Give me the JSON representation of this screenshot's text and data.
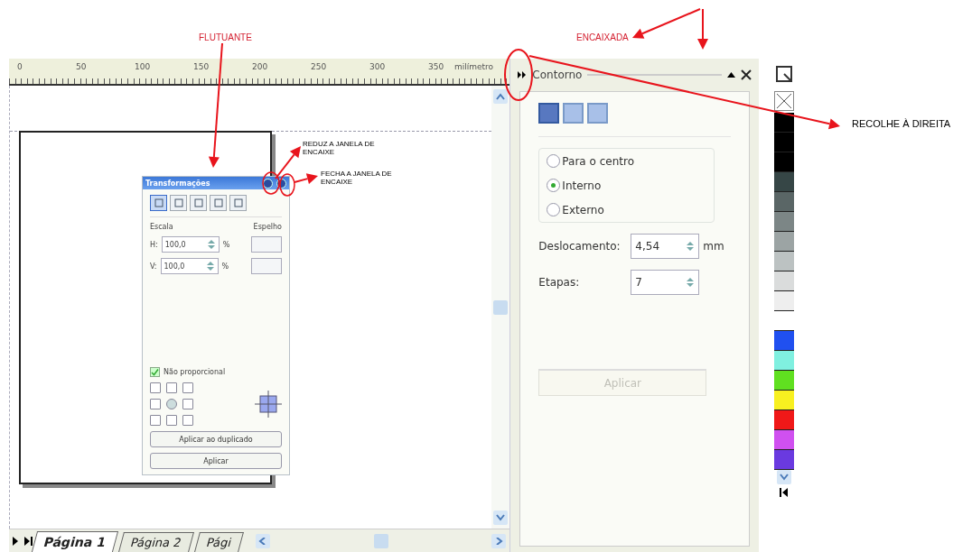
{
  "annotations": {
    "floating": "FLUTUANTE",
    "docked": "ENCAIXADA",
    "collapse_right": "RECOLHE À DIREITA",
    "shrink_docker": "REDUZ A JANELA DE ENCAIXE",
    "close_docker": "FECHA A JANELA DE ENCAIXE"
  },
  "ruler": {
    "ticks": [
      "0",
      "50",
      "100",
      "150",
      "200",
      "250",
      "300",
      "350"
    ],
    "unit": "milímetro"
  },
  "floating_docker": {
    "title": "Transformações",
    "tool_tabs": [
      {
        "selected": true
      },
      {
        "selected": false
      },
      {
        "selected": false
      },
      {
        "selected": false
      },
      {
        "selected": false
      }
    ],
    "scale_label": "Escala",
    "mirror_label": "Espelho",
    "fields": [
      {
        "label": "H:",
        "value": "100,0",
        "unit": "%"
      },
      {
        "label": "V:",
        "value": "100,0",
        "unit": "%"
      }
    ],
    "proportional": {
      "label": "Não proporcional",
      "checked": true
    },
    "anchor_points": [
      {
        "selected": false
      },
      {
        "selected": false
      },
      {
        "selected": false
      },
      {
        "selected": false
      },
      {
        "selected": true
      },
      {
        "selected": false
      },
      {
        "selected": false
      },
      {
        "selected": false
      },
      {
        "selected": false
      }
    ],
    "buttons": [
      "Aplicar ao duplicado",
      "Aplicar"
    ]
  },
  "docker": {
    "title": "Contorno",
    "modes": [
      {
        "selected": true
      },
      {
        "selected": false
      },
      {
        "selected": false
      }
    ],
    "directions": [
      {
        "label": "Para o centro",
        "selected": false
      },
      {
        "label": "Interno",
        "selected": true
      },
      {
        "label": "Externo",
        "selected": false
      }
    ],
    "offset": {
      "label": "Deslocamento:",
      "value": "4,54",
      "unit": "mm"
    },
    "steps": {
      "label": "Etapas:",
      "value": "7"
    },
    "apply": {
      "label": "Aplicar",
      "disabled": true
    }
  },
  "palette": [
    {
      "color": "#000000"
    },
    {
      "color": "#000000"
    },
    {
      "color": "#000000"
    },
    {
      "color": "#364646"
    },
    {
      "color": "#5a6666"
    },
    {
      "color": "#7c8686"
    },
    {
      "color": "#9ca4a4"
    },
    {
      "color": "#bcc2c2"
    },
    {
      "color": "#dadcdc"
    },
    {
      "color": "#eeeeee"
    },
    {
      "color": "#ffffff"
    },
    {
      "color": "#2050f0"
    },
    {
      "color": "#80f0e0"
    },
    {
      "color": "#60e020"
    },
    {
      "color": "#f8f020"
    },
    {
      "color": "#f01818"
    },
    {
      "color": "#d050f0"
    },
    {
      "color": "#6a3ae0"
    }
  ],
  "page_tabs": [
    {
      "label": "Página 1",
      "selected": true
    },
    {
      "label": "Página 2",
      "selected": false
    },
    {
      "label": "Pági",
      "selected": false
    }
  ]
}
